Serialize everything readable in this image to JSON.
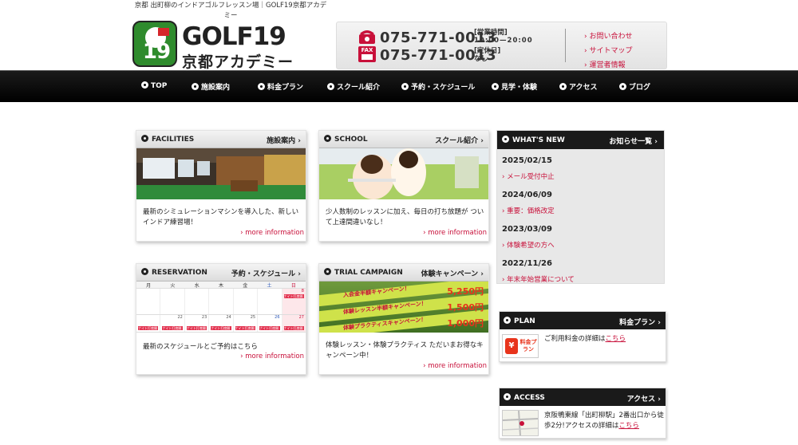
{
  "header": {
    "tagline": "京都 出町柳のインドアゴルフレッスン場｜GOLF19京都アカデミー",
    "logo_num": "19",
    "logo_word": "GOLF19",
    "logo_sub": "京都アカデミー",
    "tel": "075-771-0013",
    "fax": "075-771-0013",
    "hours_label": "営業時間",
    "hours_value": "10:00—20:00",
    "closed_label": "定休日",
    "closed_value": "なし",
    "fax_badge": "FAX",
    "links": [
      "お問い合わせ",
      "サイトマップ",
      "運営者情報"
    ]
  },
  "nav": [
    "TOP",
    "施設案内",
    "料金プラン",
    "スクール紹介",
    "予約・スケジュール",
    "見学・体験",
    "アクセス",
    "ブログ"
  ],
  "cards": [
    {
      "en": "FACILITIES",
      "jp": "施設案内 ›",
      "text": "最新のシミュレーションマシンを導入した、新しいインドア練習場！",
      "more": "more information"
    },
    {
      "en": "SCHOOL",
      "jp": "スクール紹介 ›",
      "text": "少人数制のレッスンに加え、毎日の打ち放題が ついて上達間違いなし！",
      "more": "more information"
    },
    {
      "en": "RESERVATION",
      "jp": "予約・スケジュール ›",
      "text": "最新のスケジュールとご予約はこちら",
      "more": "more information"
    },
    {
      "en": "TRIAL CAMPAIGN",
      "jp": "体験キャンペーン ›",
      "text": "体験レッスン・体験プラクティス ただいまお得なキャンペーン中！",
      "more": "more information"
    }
  ],
  "calendar": {
    "days": [
      "月",
      "火",
      "水",
      "木",
      "金",
      "土",
      "日"
    ],
    "top_dates": [
      "",
      "",
      "",
      "",
      "",
      "",
      "8"
    ],
    "bottom_dates": [
      "",
      "22",
      "23",
      "24",
      "25",
      "26",
      "27"
    ],
    "slot_label": "ナイト打席開放"
  },
  "campaign": {
    "rows": [
      "入会金半額キャンペーン！",
      "体験レッスン半額キャンペーン！",
      "体験プラクティスキャンペーン！"
    ],
    "prices": [
      "5,250円",
      "1,500円",
      "1,000円"
    ]
  },
  "news": {
    "en": "WHAT'S NEW",
    "jp": "お知らせ一覧 ›",
    "items": [
      {
        "date": "2025/02/15",
        "title": "メール受付中止"
      },
      {
        "date": "2024/06/09",
        "title": "重要：価格改定"
      },
      {
        "date": "2023/03/09",
        "title": "体験希望の方へ"
      },
      {
        "date": "2022/11/26",
        "title": "年末年始営業について"
      }
    ]
  },
  "plan": {
    "en": "PLAN",
    "jp": "料金プラン ›",
    "icon_text": "料金プラン",
    "text": "ご利用料金の詳細は",
    "link": "こちら"
  },
  "access": {
    "en": "ACCESS",
    "jp": "アクセス ›",
    "text": "京阪鴨東線「出町柳駅」2番出口から徒歩2分!アクセスの詳細は",
    "link": "こちら"
  },
  "colors": {
    "accent": "#c8103a",
    "nav_bg": "#000000",
    "brand_green": "#2f8b2d"
  }
}
